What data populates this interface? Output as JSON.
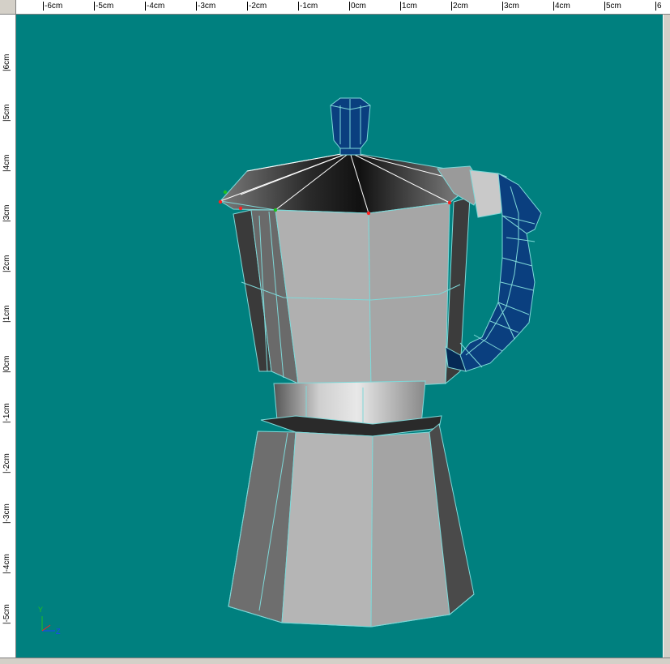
{
  "app": {
    "view_name": "3D modeling viewport"
  },
  "rulers": {
    "horizontal": [
      "-6cm",
      "-5cm",
      "-4cm",
      "-3cm",
      "-2cm",
      "-1cm",
      "0cm",
      "1cm",
      "2cm",
      "3cm",
      "4cm",
      "5cm",
      "6"
    ],
    "vertical": [
      "6cm",
      "5cm",
      "4cm",
      "3cm",
      "2cm",
      "1cm",
      "0cm",
      "-1cm",
      "-2cm",
      "-3cm",
      "-4cm",
      "-5cm"
    ]
  },
  "viewport": {
    "background_color": "#00807f",
    "model": "stovetop espresso maker mesh",
    "axis_gizmo": {
      "y_label": "Y",
      "z_label": "Z"
    }
  },
  "colors": {
    "mesh_edge": "#7fd8d8",
    "handle_blue": "#0a3f7f",
    "selected_vertex": "#ff2020",
    "green_vertex": "#20c020"
  }
}
